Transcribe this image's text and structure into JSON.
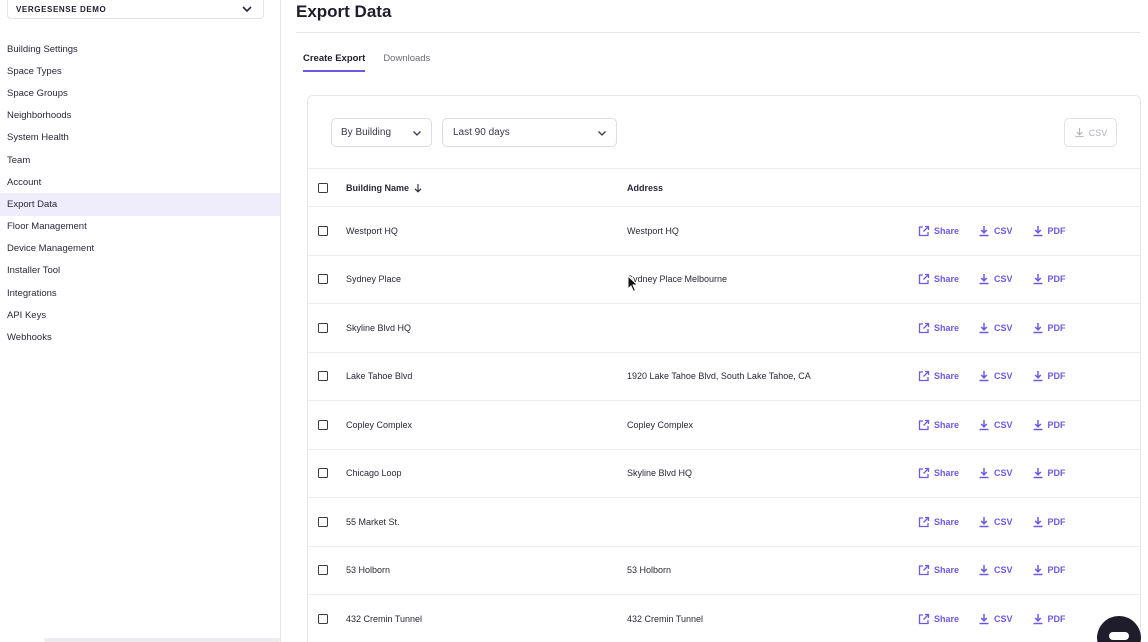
{
  "sidebar": {
    "org": "VERGESENSE DEMO",
    "items": [
      {
        "label": "Building Settings"
      },
      {
        "label": "Space Types"
      },
      {
        "label": "Space Groups"
      },
      {
        "label": "Neighborhoods"
      },
      {
        "label": "System Health"
      },
      {
        "label": "Team"
      },
      {
        "label": "Account"
      },
      {
        "label": "Export Data"
      },
      {
        "label": "Floor Management"
      },
      {
        "label": "Device Management"
      },
      {
        "label": "Installer Tool"
      },
      {
        "label": "Integrations"
      },
      {
        "label": "API Keys"
      },
      {
        "label": "Webhooks"
      }
    ],
    "active_item": "Export Data"
  },
  "main": {
    "title": "Export Data",
    "tabs": [
      {
        "label": "Create Export"
      },
      {
        "label": "Downloads"
      }
    ],
    "active_tab": "Create Export",
    "filters": {
      "grouping": "By Building",
      "range": "Last 90 days"
    },
    "csv_button": "CSV",
    "table": {
      "columns": [
        "Building Name",
        "Address"
      ],
      "actions": {
        "share": "Share",
        "csv": "CSV",
        "pdf": "PDF"
      },
      "rows": [
        {
          "name": "Westport HQ",
          "address": "Westport HQ"
        },
        {
          "name": "Sydney Place",
          "address": "Sydney Place Melbourne"
        },
        {
          "name": "Skyline Blvd HQ",
          "address": ""
        },
        {
          "name": "Lake Tahoe Blvd",
          "address": "1920 Lake Tahoe Blvd, South Lake Tahoe, CA"
        },
        {
          "name": "Copley Complex",
          "address": "Copley Complex"
        },
        {
          "name": "Chicago Loop",
          "address": "Skyline Blvd HQ"
        },
        {
          "name": "55 Market St.",
          "address": ""
        },
        {
          "name": "53 Holborn",
          "address": "53 Holborn"
        },
        {
          "name": "432 Cremin Tunnel",
          "address": "432 Cremin Tunnel"
        }
      ]
    }
  },
  "colors": {
    "accent": "#7158e2",
    "active_nav_bg": "#efedfb",
    "text": "#1f1d2b"
  }
}
